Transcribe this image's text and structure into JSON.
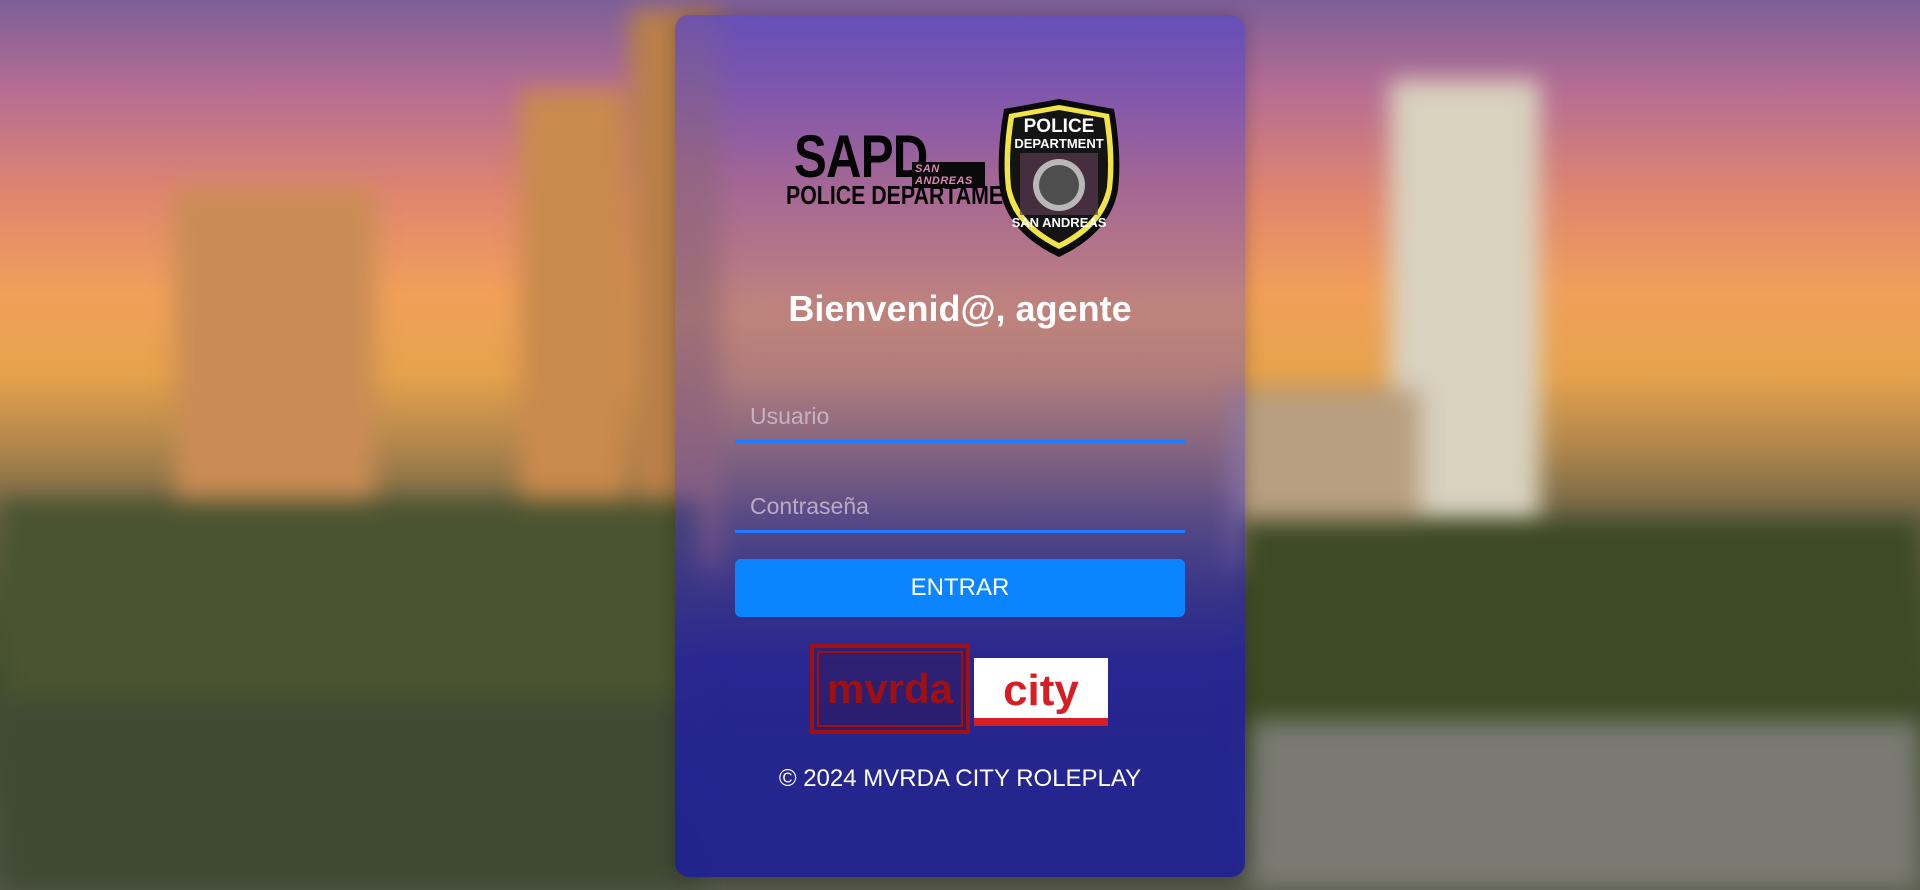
{
  "logo": {
    "sapd_big": "SAPD",
    "sapd_small": "SAN ANDREAS",
    "sapd_department": "POLICE DEPARTAMENT",
    "badge_top1": "POLICE",
    "badge_top2": "DEPARTMENT",
    "badge_bottom": "SAN ANDREAS"
  },
  "login": {
    "title": "Bienvenid@, agente",
    "username_placeholder": "Usuario",
    "username_value": "",
    "password_placeholder": "Contraseña",
    "password_value": "",
    "submit_label": "ENTRAR"
  },
  "brand": {
    "left": "mvrda",
    "right": "city"
  },
  "footer": {
    "copyright": "© 2024 MVRDA CITY ROLEPLAY"
  },
  "colors": {
    "accent": "#0a84ff",
    "input_underline": "#1f7bff",
    "brand_red": "#a01010",
    "brand_city_red": "#d81e25"
  }
}
